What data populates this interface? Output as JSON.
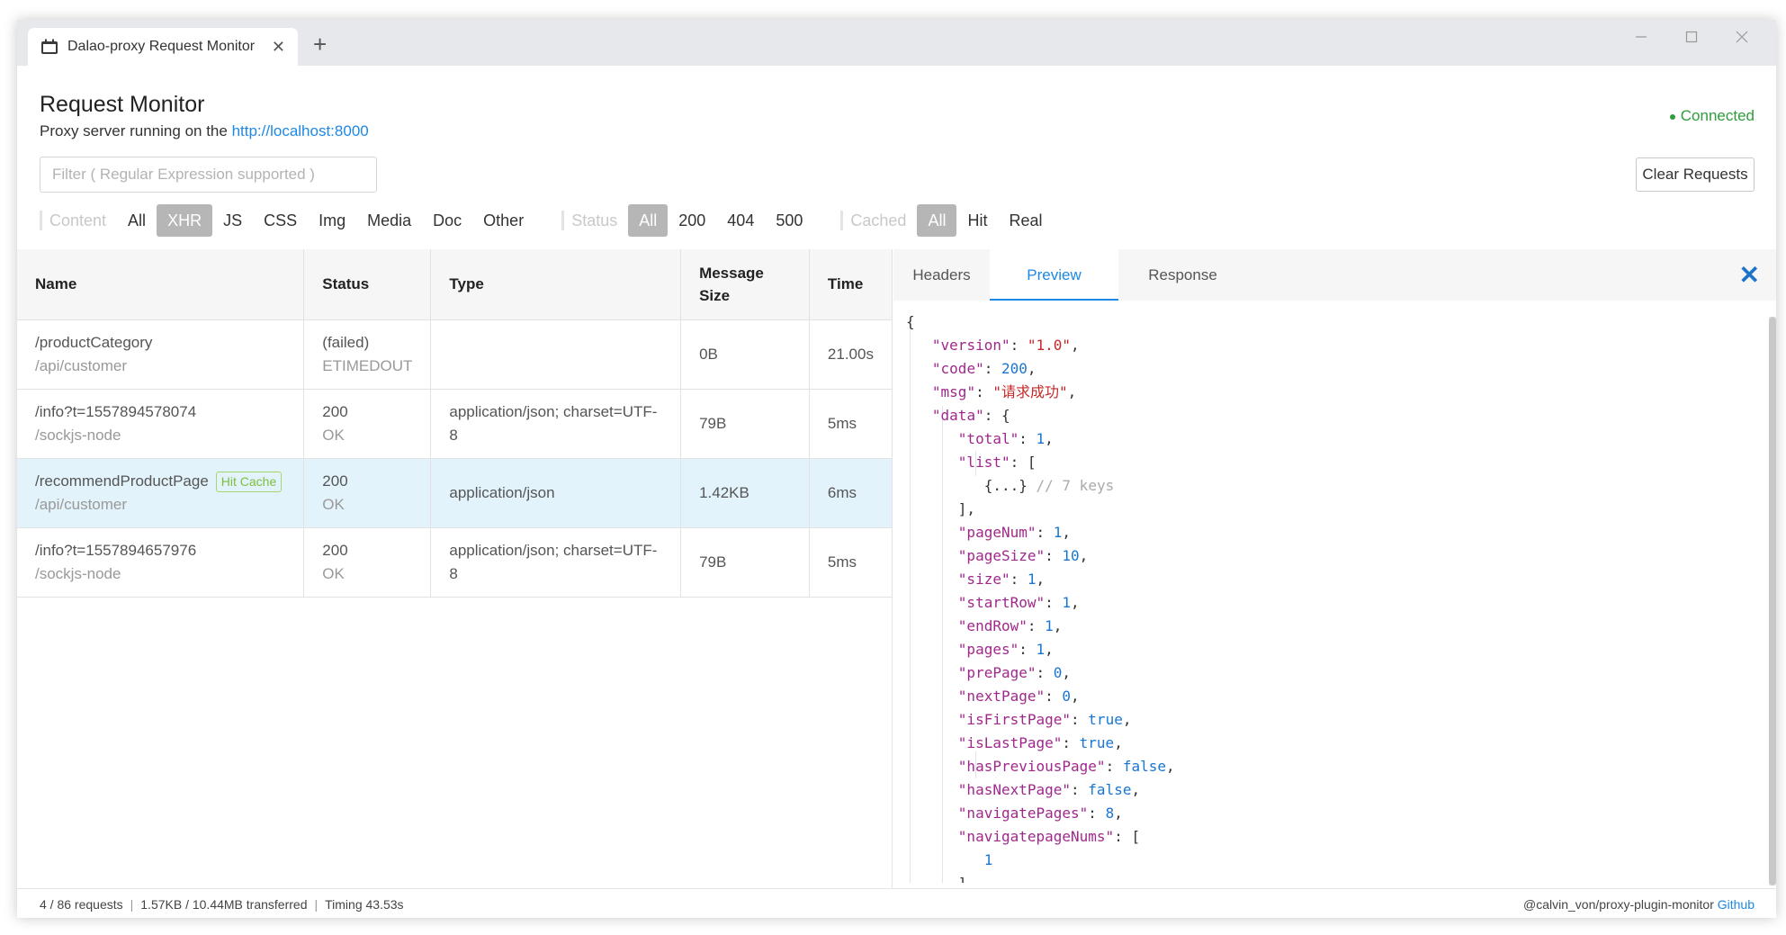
{
  "window": {
    "tab_title": "Dalao-proxy Request Monitor",
    "tab_close": "✕",
    "new_tab": "+",
    "minimize": "—",
    "maximize": "☐",
    "close": "✕"
  },
  "header": {
    "title": "Request Monitor",
    "subtitle_prefix": "Proxy server running on the ",
    "server_url": "http://localhost:8000",
    "status": "Connected"
  },
  "filter": {
    "placeholder": "Filter ( Regular Expression supported )"
  },
  "clear_button": "Clear Requests",
  "filters": {
    "content": {
      "label": "Content",
      "options": [
        "All",
        "XHR",
        "JS",
        "CSS",
        "Img",
        "Media",
        "Doc",
        "Other"
      ],
      "active": "XHR"
    },
    "status": {
      "label": "Status",
      "options": [
        "All",
        "200",
        "404",
        "500"
      ],
      "active": "All"
    },
    "cached": {
      "label": "Cached",
      "options": [
        "All",
        "Hit",
        "Real"
      ],
      "active": "All"
    }
  },
  "table": {
    "headers": {
      "name": "Name",
      "status": "Status",
      "type": "Type",
      "size": "Message Size",
      "time": "Time"
    },
    "rows": [
      {
        "name": "/productCategory",
        "path": "/api/customer",
        "status": "(failed)",
        "status_text": "ETIMEDOUT",
        "type": "",
        "size": "0B",
        "time": "21.00s",
        "badge": ""
      },
      {
        "name": "/info?t=1557894578074",
        "path": "/sockjs-node",
        "status": "200",
        "status_text": "OK",
        "type": "application/json; charset=UTF-8",
        "size": "79B",
        "time": "5ms",
        "badge": ""
      },
      {
        "name": "/recommendProductPage",
        "path": "/api/customer",
        "status": "200",
        "status_text": "OK",
        "type": "application/json",
        "size": "1.42KB",
        "time": "6ms",
        "badge": "Hit Cache"
      },
      {
        "name": "/info?t=1557894657976",
        "path": "/sockjs-node",
        "status": "200",
        "status_text": "OK",
        "type": "application/json; charset=UTF-8",
        "size": "79B",
        "time": "5ms",
        "badge": ""
      }
    ]
  },
  "panel": {
    "tabs": [
      "Headers",
      "Preview",
      "Response"
    ],
    "active_tab": "Preview",
    "close": "✕"
  },
  "preview": {
    "open": "{",
    "version_key": "\"version\"",
    "version_val": "\"1.0\"",
    "code_key": "\"code\"",
    "code_val": "200",
    "msg_key": "\"msg\"",
    "msg_val": "\"请求成功\"",
    "data_key": "\"data\"",
    "total_key": "\"total\"",
    "total_val": "1",
    "list_key": "\"list\"",
    "list_item": "{...}",
    "list_comment": "// 7 keys",
    "list_close": "],",
    "pageNum_key": "\"pageNum\"",
    "pageNum_val": "1",
    "pageSize_key": "\"pageSize\"",
    "pageSize_val": "10",
    "size_key": "\"size\"",
    "size_val": "1",
    "startRow_key": "\"startRow\"",
    "startRow_val": "1",
    "endRow_key": "\"endRow\"",
    "endRow_val": "1",
    "pages_key": "\"pages\"",
    "pages_val": "1",
    "prePage_key": "\"prePage\"",
    "prePage_val": "0",
    "nextPage_key": "\"nextPage\"",
    "nextPage_val": "0",
    "isFirstPage_key": "\"isFirstPage\"",
    "isFirstPage_val": "true",
    "isLastPage_key": "\"isLastPage\"",
    "isLastPage_val": "true",
    "hasPreviousPage_key": "\"hasPreviousPage\"",
    "hasPreviousPage_val": "false",
    "hasNextPage_key": "\"hasNextPage\"",
    "hasNextPage_val": "false",
    "navigatePages_key": "\"navigatePages\"",
    "navigatePages_val": "8",
    "navigatepageNums_key": "\"navigatepageNums\"",
    "nums_item": "1",
    "nums_close": "]"
  },
  "footer": {
    "requests": "4 / 86 requests",
    "transferred": "1.57KB / 10.44MB transferred",
    "timing": "Timing 43.53s",
    "credit": "@calvin_von/proxy-plugin-monitor ",
    "link": "Github"
  }
}
